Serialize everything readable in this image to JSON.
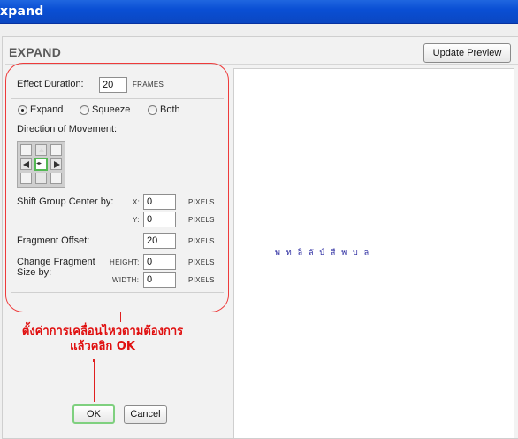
{
  "window": {
    "title": "xpand"
  },
  "header": {
    "heading": "EXPAND",
    "update_preview_label": "Update Preview"
  },
  "effect_duration": {
    "label": "Effect Duration:",
    "value": "20",
    "unit": "FRAMES"
  },
  "mode": {
    "options": [
      {
        "label": "Expand",
        "selected": true
      },
      {
        "label": "Squeeze",
        "selected": false
      },
      {
        "label": "Both",
        "selected": false
      }
    ]
  },
  "direction": {
    "label": "Direction of Movement:",
    "selected": "center",
    "center_glyph": "◂▸"
  },
  "shift_center": {
    "label": "Shift Group Center by:",
    "x_label": "X:",
    "x_value": "0",
    "y_label": "Y:",
    "y_value": "0",
    "unit": "PIXELS"
  },
  "fragment_offset": {
    "label": "Fragment Offset:",
    "value": "20",
    "unit": "PIXELS"
  },
  "fragment_size": {
    "label_line1": "Change Fragment",
    "label_line2": "Size by:",
    "height_label": "HEIGHT:",
    "height_value": "0",
    "width_label": "WIDTH:",
    "width_value": "0",
    "unit": "PIXELS"
  },
  "preview": {
    "text": "พ ท ลิ ลั บ์ สื พ บ ล"
  },
  "annotation": {
    "line1": "ตั้งค่าการเคลื่อนไหวตามต้องการ",
    "line2": "แล้วคลิก OK",
    "color": "#e01010"
  },
  "footer": {
    "ok_label": "OK",
    "cancel_label": "Cancel"
  }
}
